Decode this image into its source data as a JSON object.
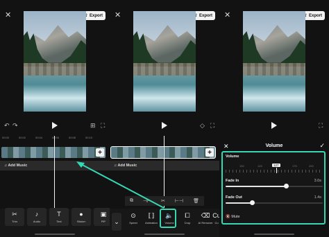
{
  "top": {
    "close_icon": "✕",
    "export_label": "Export"
  },
  "panel1": {
    "ruler_ticks": [
      "00:00",
      "00:02",
      "00:04",
      "00:06",
      "00:08",
      "00:10",
      "00:12"
    ],
    "time_text": "00:00",
    "add_music": "Add Music",
    "add_clip": "+",
    "toolbar": [
      {
        "icon": "✂",
        "label": "Trim"
      },
      {
        "icon": "♪",
        "label": "Audio"
      },
      {
        "icon": "T",
        "label": "Text"
      },
      {
        "icon": "●",
        "label": "Sticker"
      },
      {
        "icon": "▣",
        "label": "PiP"
      }
    ]
  },
  "panel2": {
    "add_music": "Add Music",
    "add_clip": "+",
    "clip_tools": [
      "⧉",
      "⊣⊢",
      "✂",
      "⊢⊣",
      "🗑"
    ],
    "toolbar": [
      {
        "icon": "⌄",
        "label": ""
      },
      {
        "icon": "⊙",
        "label": "Speed"
      },
      {
        "icon": "⟦⟧",
        "label": "Animation"
      },
      {
        "icon": "🔈",
        "label": "Volume"
      },
      {
        "icon": "⧠",
        "label": "Crop"
      },
      {
        "icon": "⌫",
        "label": "AI Remover"
      },
      {
        "icon": "Cu",
        "label": "Cu"
      }
    ]
  },
  "panel3": {
    "header_title": "Volume",
    "volume_label": "Volume",
    "volume_value": 127,
    "volume_scale": [
      "150",
      "125",
      "127",
      "150",
      "175",
      "200"
    ],
    "fade_in_label": "Fade In",
    "fade_in_value": "3.0s",
    "fade_out_label": "Fade Out",
    "fade_out_value": "1.4s",
    "mute_label": "Mute"
  },
  "colors": {
    "accent": "#35d9b4"
  }
}
